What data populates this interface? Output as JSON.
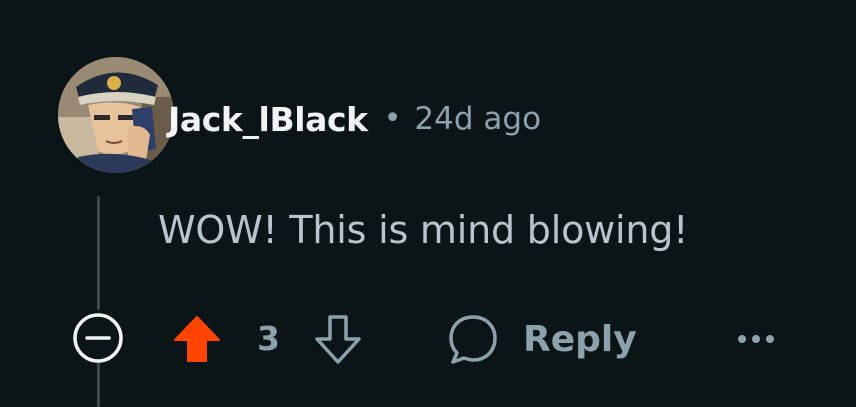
{
  "comment": {
    "author": "Jack_lBlack",
    "separator": "•",
    "timestamp": "24d ago",
    "body": "WOW! This is mind blowing!",
    "score": "3",
    "reply_label": "Reply"
  },
  "icons": {
    "collapse": "minus-circle-icon",
    "upvote": "arrow-up-filled-icon",
    "downvote": "arrow-down-outline-icon",
    "reply": "speech-bubble-icon",
    "more": "ellipsis-icon"
  },
  "colors": {
    "background": "#0b1416",
    "upvote_active": "#ff4500",
    "muted_text": "#8ba2ad",
    "body_text": "#b8c5cc",
    "author_text": "#f2f4f5"
  }
}
